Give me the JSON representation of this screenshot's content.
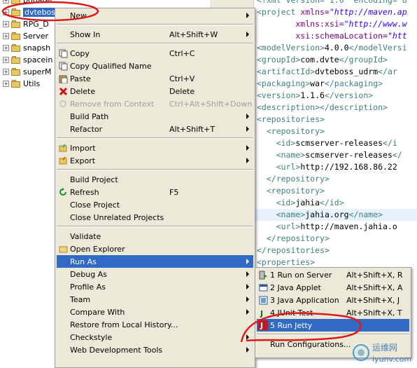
{
  "tree": {
    "items": [
      "bonarel",
      "dvteboss_udrm",
      "RPG_D",
      "Server",
      "snapsh",
      "spacein",
      "superM",
      "Utils"
    ]
  },
  "editor": {
    "lines": [
      {
        "parts": [
          [
            "tag",
            "<?xml version=\"1.0\" encoding=\"U"
          ]
        ]
      },
      {
        "parts": [
          [
            "tag",
            "<project "
          ],
          [
            "attr",
            "xmlns="
          ],
          [
            "val",
            "\"http://maven.ap"
          ]
        ]
      },
      {
        "parts": [
          [
            "attr",
            "        xmlns:xsi="
          ],
          [
            "val",
            "\"http://www.w"
          ]
        ]
      },
      {
        "parts": [
          [
            "attr",
            "        xsi:schemaLocation="
          ],
          [
            "val",
            "\"htt"
          ]
        ]
      },
      {
        "parts": [
          [
            "tag",
            "<modelVersion>"
          ],
          [
            "txt",
            "4.0.0"
          ],
          [
            "tag",
            "</modelVersi"
          ]
        ]
      },
      {
        "parts": [
          [
            "tag",
            "<groupId>"
          ],
          [
            "txt",
            "com.dvte"
          ],
          [
            "tag",
            "</groupId>"
          ]
        ]
      },
      {
        "parts": [
          [
            "tag",
            "<artifactId>"
          ],
          [
            "txt",
            "dvteboss_udrm"
          ],
          [
            "tag",
            "</ar"
          ]
        ]
      },
      {
        "parts": [
          [
            "tag",
            "<packaging>"
          ],
          [
            "txt",
            "war"
          ],
          [
            "tag",
            "</packaging>"
          ]
        ]
      },
      {
        "parts": [
          [
            "tag",
            "<version>"
          ],
          [
            "txt",
            "1.1.6"
          ],
          [
            "tag",
            "</version>"
          ]
        ]
      },
      {
        "parts": [
          [
            "tag",
            "<description></description>"
          ]
        ]
      },
      {
        "parts": [
          [
            "tag",
            "<repositories>"
          ]
        ]
      },
      {
        "parts": [
          [
            "tag",
            "  <repository>"
          ]
        ]
      },
      {
        "parts": [
          [
            "tag",
            "    <id>"
          ],
          [
            "txt",
            "scmserver-releases"
          ],
          [
            "tag",
            "</i"
          ]
        ]
      },
      {
        "parts": [
          [
            "tag",
            "    <name>"
          ],
          [
            "txt",
            "scmserver-releases"
          ],
          [
            "tag",
            "</"
          ]
        ]
      },
      {
        "parts": [
          [
            "tag",
            "    <url>"
          ],
          [
            "txt",
            "http://192.168.86.22"
          ]
        ]
      },
      {
        "parts": [
          [
            "tag",
            "  </repository>"
          ]
        ]
      },
      {
        "parts": [
          [
            "tag",
            "  <repository>"
          ]
        ]
      },
      {
        "parts": [
          [
            "tag",
            "    <id>"
          ],
          [
            "txt",
            "jahia"
          ],
          [
            "tag",
            "</id>"
          ]
        ]
      },
      {
        "parts": [
          [
            "tag",
            "    <name>"
          ],
          [
            "txt",
            "jahia.org"
          ],
          [
            "tag",
            "</name>"
          ]
        ],
        "hl": true
      },
      {
        "parts": [
          [
            "tag",
            "    <url>"
          ],
          [
            "txt",
            "http://maven.jahia.o"
          ]
        ]
      },
      {
        "parts": [
          [
            "tag",
            "  </repository>"
          ]
        ]
      },
      {
        "parts": [
          [
            "tag",
            "</repositories>"
          ]
        ]
      },
      {
        "parts": [
          [
            "tag",
            "<properties>"
          ]
        ]
      }
    ]
  },
  "context_menu": {
    "items": [
      {
        "label": "New",
        "accel": "",
        "sub": true,
        "icon": ""
      },
      {
        "sep": true
      },
      {
        "label": "Show In",
        "accel": "Alt+Shift+W",
        "sub": true,
        "icon": ""
      },
      {
        "sep": true
      },
      {
        "label": "Copy",
        "accel": "Ctrl+C",
        "icon": "copy-icon"
      },
      {
        "label": "Copy Qualified Name",
        "accel": "",
        "icon": "copy-qualified-icon"
      },
      {
        "label": "Paste",
        "accel": "Ctrl+V",
        "icon": "paste-icon"
      },
      {
        "label": "Delete",
        "accel": "Delete",
        "icon": "delete-icon"
      },
      {
        "label": "Remove from Context",
        "accel": "Ctrl+Alt+Shift+Down",
        "disabled": true,
        "icon": "remove-context-icon"
      },
      {
        "label": "Build Path",
        "accel": "",
        "sub": true
      },
      {
        "label": "Refactor",
        "accel": "Alt+Shift+T",
        "sub": true
      },
      {
        "sep": true
      },
      {
        "label": "Import",
        "accel": "",
        "sub": true,
        "icon": "import-icon"
      },
      {
        "label": "Export",
        "accel": "",
        "sub": true,
        "icon": "export-icon"
      },
      {
        "sep": true
      },
      {
        "label": "Build Project",
        "accel": ""
      },
      {
        "label": "Refresh",
        "accel": "F5",
        "icon": "refresh-icon"
      },
      {
        "label": "Close Project",
        "accel": ""
      },
      {
        "label": "Close Unrelated Projects",
        "accel": ""
      },
      {
        "sep": true
      },
      {
        "label": "Validate",
        "accel": ""
      },
      {
        "label": "Open Explorer",
        "accel": "",
        "icon": "explorer-icon"
      },
      {
        "label": "Run As",
        "accel": "",
        "sub": true,
        "active": true
      },
      {
        "label": "Debug As",
        "accel": "",
        "sub": true
      },
      {
        "label": "Profile As",
        "accel": "",
        "sub": true
      },
      {
        "label": "Team",
        "accel": "",
        "sub": true
      },
      {
        "label": "Compare With",
        "accel": "",
        "sub": true
      },
      {
        "label": "Restore from Local History...",
        "accel": ""
      },
      {
        "label": "Checkstyle",
        "accel": "",
        "sub": true
      },
      {
        "label": "Web Development Tools",
        "accel": "",
        "sub": true
      }
    ]
  },
  "submenu": {
    "items": [
      {
        "label": "1 Run on Server",
        "accel": "Alt+Shift+X, R",
        "icon": "server-run-icon"
      },
      {
        "label": "2 Java Applet",
        "accel": "Alt+Shift+X, A",
        "icon": "applet-icon"
      },
      {
        "label": "3 Java Application",
        "accel": "Alt+Shift+X, J",
        "icon": "java-app-icon"
      },
      {
        "label": "4 JUnit Test",
        "accel": "Alt+Shift+X, T",
        "icon": "junit-icon"
      },
      {
        "label": "5 Run Jetty",
        "accel": "",
        "icon": "jetty-icon",
        "active": true
      },
      {
        "sep": true
      },
      {
        "label": "Run Configurations...",
        "accel": ""
      }
    ]
  },
  "watermark": {
    "text_cn": "运维网",
    "text_en": "iyunv.com"
  },
  "colors": {
    "highlight": "#316ac5",
    "annotation": "#e0181a",
    "menu_bg": "#ece9d8"
  }
}
